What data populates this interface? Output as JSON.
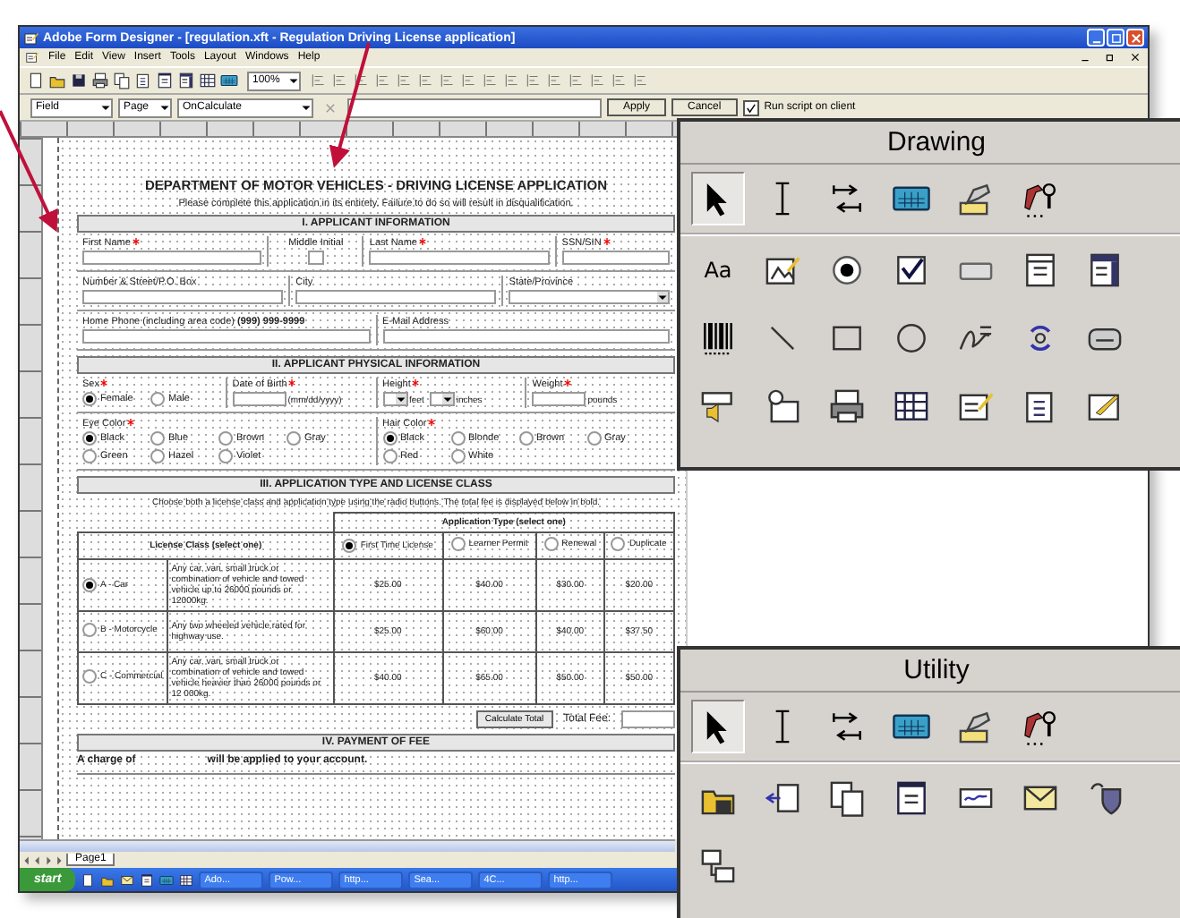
{
  "window": {
    "title": "Adobe Form Designer - [regulation.xft - Regulation Driving License application]"
  },
  "menu": [
    "File",
    "Edit",
    "View",
    "Insert",
    "Tools",
    "Layout",
    "Windows",
    "Help"
  ],
  "toolbar": {
    "zoom": "100%"
  },
  "script_bar": {
    "object": "Field",
    "scope": "Page",
    "event": "OnCalculate",
    "apply": "Apply",
    "cancel": "Cancel",
    "run_on_client": {
      "label": "Run script on client",
      "checked": true
    }
  },
  "form": {
    "title": "DEPARTMENT OF MOTOR VEHICLES - DRIVING LICENSE APPLICATION",
    "instructions": "Please complete this application in its entirety. Failure to do so will result in disqualification.",
    "sections": [
      {
        "kind": "fields",
        "header": "I. APPLICANT INFORMATION",
        "lines": [
          {
            "fields": [
              {
                "label": "First Name",
                "required": true,
                "kind": "input"
              },
              {
                "label": "Middle Initial",
                "required": false,
                "kind": "box"
              },
              {
                "label": "Last Name",
                "required": true,
                "kind": "input"
              },
              {
                "label": "SSN/SIN",
                "required": true,
                "kind": "short"
              }
            ]
          },
          {
            "fields": [
              {
                "label": "Number & Street/P.O. Box",
                "required": false,
                "kind": "input"
              },
              {
                "label": "City",
                "required": false,
                "kind": "input"
              },
              {
                "label": "State/Province",
                "required": false,
                "kind": "select"
              }
            ]
          },
          {
            "fields": [
              {
                "label": "Home Phone (including area code) **(999) 999-9999**",
                "required": false,
                "kind": "input"
              },
              {
                "label": "E-Mail Address",
                "required": false,
                "kind": "input"
              }
            ]
          }
        ]
      },
      {
        "kind": "fields",
        "header": "II. APPLICANT PHYSICAL INFORMATION",
        "lines": [
          {
            "fields": [
              {
                "label": "Sex",
                "required": true,
                "kind": "radios",
                "options": [
                  {
                    "label": "Female",
                    "selected": true
                  },
                  {
                    "label": "Male",
                    "selected": false
                  }
                ]
              },
              {
                "label": "Date of Birth",
                "required": true,
                "kind": "units",
                "parts": [
                  {
                    "kind": "input",
                    "unit": "(mm/dd/yyyy)"
                  }
                ]
              },
              {
                "label": "Height",
                "required": true,
                "kind": "units",
                "parts": [
                  {
                    "kind": "select",
                    "unit": "feet"
                  },
                  {
                    "kind": "select",
                    "unit": "inches"
                  }
                ]
              },
              {
                "label": "Weight",
                "required": true,
                "kind": "units",
                "parts": [
                  {
                    "kind": "input",
                    "unit": "pounds"
                  }
                ]
              }
            ]
          },
          {
            "fields": [
              {
                "label": "Eye Color",
                "required": true,
                "kind": "radios",
                "options": [
                  {
                    "label": "Black",
                    "selected": true
                  },
                  {
                    "label": "Blue",
                    "selected": false
                  },
                  {
                    "label": "Brown",
                    "selected": false
                  },
                  {
                    "label": "Gray",
                    "selected": false
                  },
                  {
                    "label": "Green",
                    "selected": false
                  },
                  {
                    "label": "Hazel",
                    "selected": false
                  },
                  {
                    "label": "Violet",
                    "selected": false
                  }
                ]
              },
              {
                "label": "Hair Color",
                "required": true,
                "kind": "radios",
                "options": [
                  {
                    "label": "Black",
                    "selected": true
                  },
                  {
                    "label": "Blonde",
                    "selected": false
                  },
                  {
                    "label": "Brown",
                    "selected": false
                  },
                  {
                    "label": "Gray",
                    "selected": false
                  },
                  {
                    "label": "Red",
                    "selected": false
                  },
                  {
                    "label": "White",
                    "selected": false
                  }
                ]
              }
            ]
          }
        ]
      },
      {
        "kind": "fee_table",
        "header": "III. APPLICATION TYPE AND LICENSE CLASS",
        "instructions": "Choose both a license class and application type using the radio buttons. The total fee is displayed below in bold.",
        "type_header": "Application Type (select one)",
        "class_header": "License Class (select one)",
        "types": [
          {
            "label": "First Time License",
            "selected": true
          },
          {
            "label": "Learner Permit",
            "selected": false
          },
          {
            "label": "Renewal",
            "selected": false
          },
          {
            "label": "Duplicate",
            "selected": false
          }
        ],
        "rows": [
          {
            "class": "A - Car",
            "selected": true,
            "description": "Any car, van, small truck or combination of vehicle and towed vehicle up to 26000 pounds or 12000kg.",
            "fees": [
              "$25.00",
              "$40.00",
              "$30.00",
              "$20.00"
            ]
          },
          {
            "class": "B - Motorcycle",
            "selected": false,
            "description": "Any two wheeled vehicle rated for highway use.",
            "fees": [
              "$25.00",
              "$60.00",
              "$40.00",
              "$37.50"
            ]
          },
          {
            "class": "C - Commercial",
            "selected": false,
            "description": "Any car, van, small truck or combination of vehicle and towed vehicle heavier than 26000 pounds or 12 000kg.",
            "fees": [
              "$40.00",
              "$65.00",
              "$50.00",
              "$50.00"
            ]
          }
        ],
        "calculate": "Calculate Total",
        "total_label": "Total Fee:"
      },
      {
        "kind": "payment",
        "header": "IV. PAYMENT OF FEE",
        "before": "A charge of",
        "after": "will be applied to your account."
      }
    ]
  },
  "sheet_tabs": [
    {
      "label": "Page1",
      "selected": true
    }
  ],
  "taskbar": {
    "start": "start",
    "items": [
      "Ado...",
      "Pow...",
      "http...",
      "Sea...",
      "4C...",
      "http..."
    ]
  },
  "palettes": [
    {
      "title": "Drawing",
      "rows": [
        [
          {
            "kind": "pointer",
            "selected": true
          },
          {
            "kind": "text-cursor",
            "selected": false
          },
          {
            "kind": "tab-arrows",
            "selected": false
          },
          {
            "kind": "calculator",
            "selected": false
          },
          {
            "kind": "stamp",
            "selected": false
          },
          {
            "kind": "hammer",
            "selected": false
          }
        ],
        [
          {
            "kind": "text",
            "glyph": "Aa",
            "selected": false
          },
          {
            "kind": "picture-pen",
            "selected": false
          },
          {
            "kind": "radio-button",
            "selected": false
          },
          {
            "kind": "checkbox",
            "selected": false
          },
          {
            "kind": "button",
            "selected": false
          },
          {
            "kind": "list",
            "selected": false
          },
          {
            "kind": "window-list",
            "selected": false
          }
        ],
        [
          {
            "kind": "barcode",
            "selected": false
          },
          {
            "kind": "line",
            "selected": false
          },
          {
            "kind": "rectangle",
            "selected": false
          },
          {
            "kind": "circle",
            "selected": false
          },
          {
            "kind": "signature",
            "selected": false
          },
          {
            "kind": "refresh-arrows",
            "selected": false
          },
          {
            "kind": "drive",
            "selected": false
          }
        ],
        [
          {
            "kind": "speaker",
            "selected": false
          },
          {
            "kind": "clock-window",
            "selected": false
          },
          {
            "kind": "printer",
            "selected": false
          },
          {
            "kind": "grid",
            "selected": false
          },
          {
            "kind": "document-pen",
            "selected": false
          },
          {
            "kind": "clipboard",
            "selected": false
          },
          {
            "kind": "window-pen",
            "selected": false
          }
        ]
      ]
    },
    {
      "title": "Utility",
      "rows": [
        [
          {
            "kind": "pointer",
            "selected": true
          },
          {
            "kind": "text-cursor",
            "selected": false
          },
          {
            "kind": "tab-arrows",
            "selected": false
          },
          {
            "kind": "calculator",
            "selected": false
          },
          {
            "kind": "stamp",
            "selected": false
          },
          {
            "kind": "hammer",
            "selected": false
          }
        ],
        [
          {
            "kind": "folder-disk",
            "selected": false
          },
          {
            "kind": "document-arrow",
            "selected": false
          },
          {
            "kind": "documents",
            "selected": false
          },
          {
            "kind": "document",
            "selected": false
          },
          {
            "kind": "image-field",
            "selected": false
          },
          {
            "kind": "envelope",
            "selected": false
          },
          {
            "kind": "shield",
            "selected": false
          }
        ],
        [
          {
            "kind": "computers",
            "selected": false
          }
        ]
      ]
    }
  ]
}
